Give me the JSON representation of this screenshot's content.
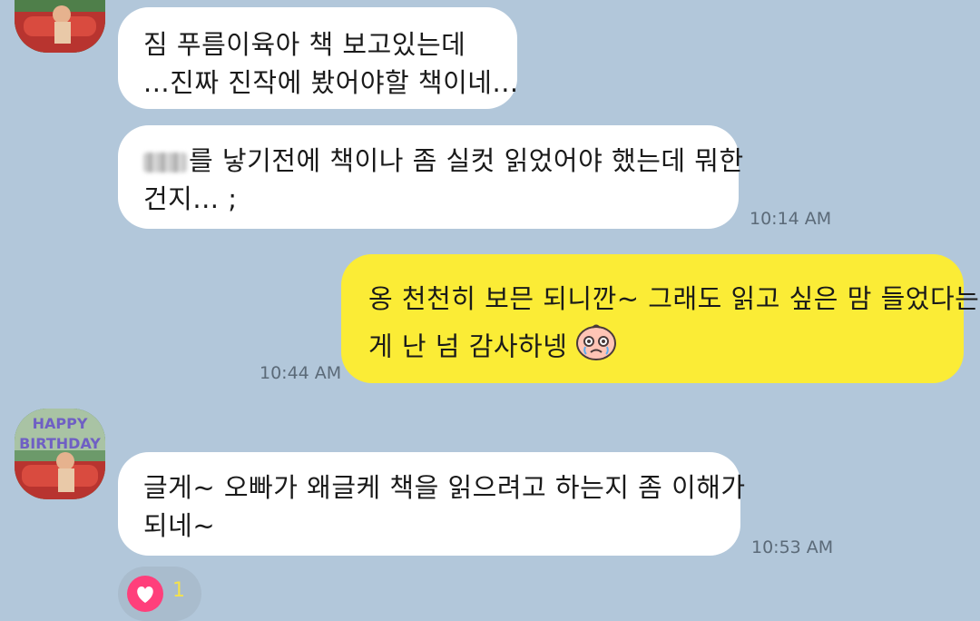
{
  "chat": {
    "messages": [
      {
        "sender": "friend",
        "lines": [
          "짐 푸름이육아 책 보고있는데",
          "...진짜 진작에 봤어야할 책이네..."
        ],
        "time": ""
      },
      {
        "sender": "friend",
        "lines": [
          "를 낳기전에 책이나 좀 실컷 읽었어야 했는데 뭐한",
          "건지... ;"
        ],
        "time": "10:14 AM"
      },
      {
        "sender": "me",
        "lines": [
          "옹 천천히 보믄 되니깐~ 그래도 읽고 싶은 맘 들었다는",
          "게 난 넘 감사하넹"
        ],
        "time": "10:44 AM"
      },
      {
        "sender": "friend",
        "lines": [
          "글게~ 오빠가 왜글케 책을 읽으려고 하는지 좀 이해가",
          "되네~"
        ],
        "time": "10:53 AM"
      }
    ],
    "avatar_text": {
      "line1": "HAPPY",
      "line2": "BIRTHDAY"
    },
    "reaction": {
      "icon": "heart-icon",
      "count": "1",
      "color": "#ff3f7b"
    },
    "colors": {
      "background": "#b2c7da",
      "incoming_bubble": "#ffffff",
      "outgoing_bubble": "#fbec36"
    },
    "emoticon": "crying-peach-emoticon"
  }
}
